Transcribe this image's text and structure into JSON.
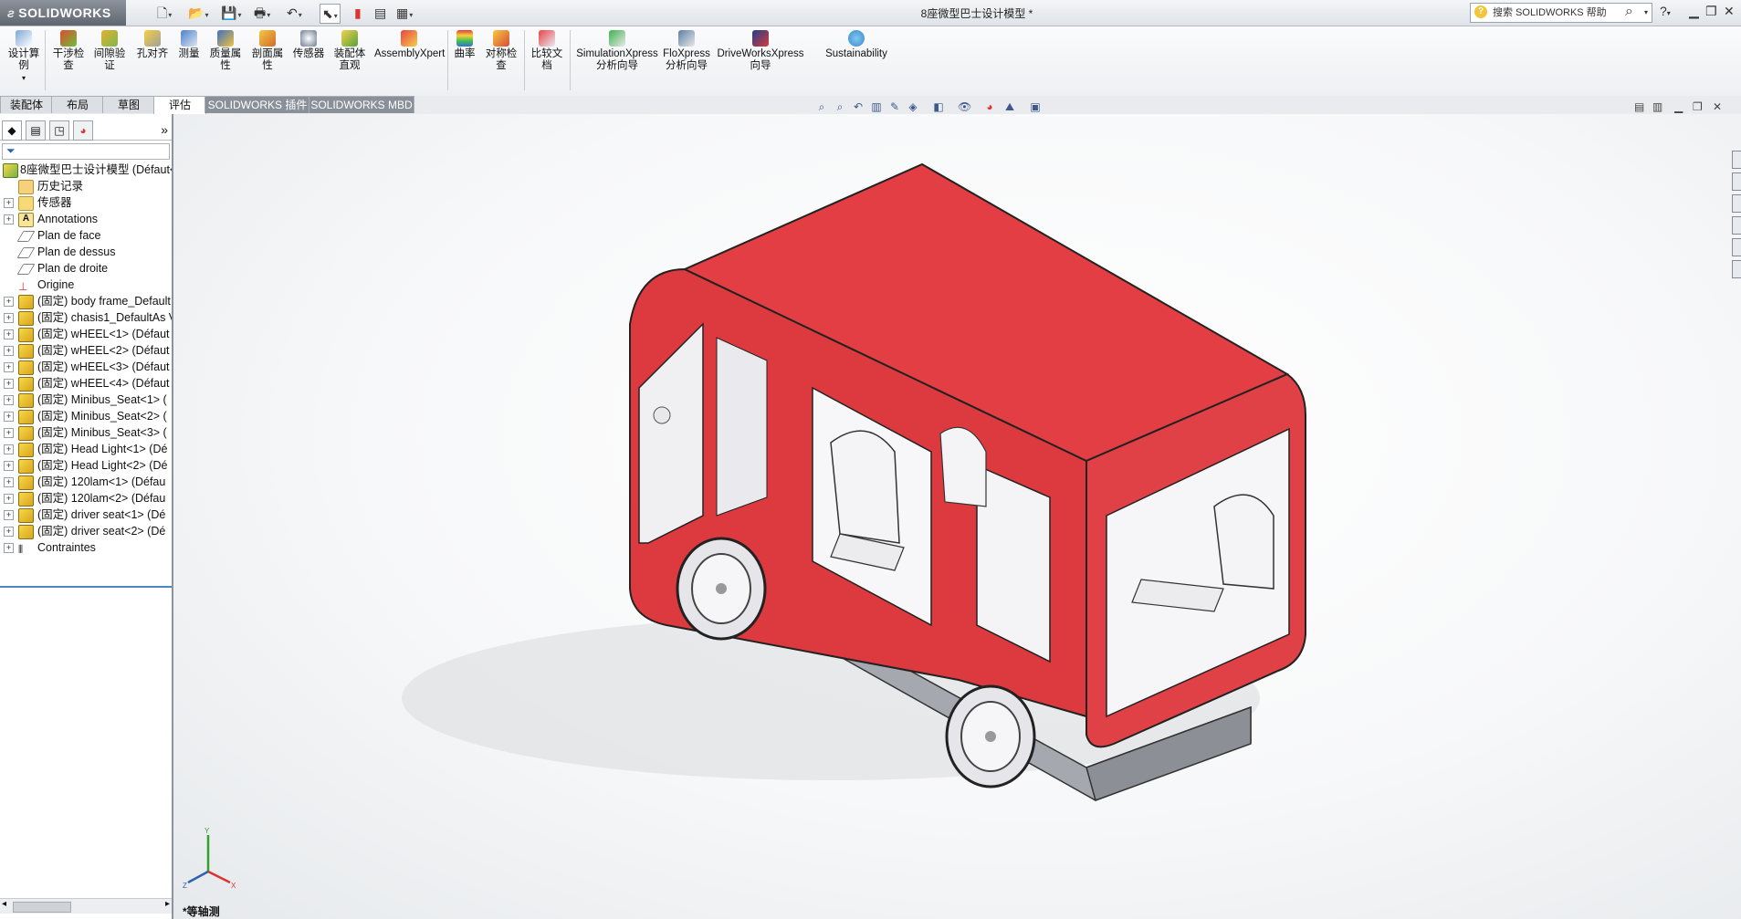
{
  "app": {
    "logo_text": "SOLIDWORKS",
    "document_title": "8座微型巴士设计模型 *",
    "search_placeholder": "搜索 SOLIDWORKS 帮助"
  },
  "ribbon": {
    "buttons": [
      {
        "label": "设计算\n例",
        "icon": "design-study-icon"
      },
      {
        "label": "干涉检\n查",
        "icon": "interference-icon"
      },
      {
        "label": "间隙验\n证",
        "icon": "clearance-icon"
      },
      {
        "label": "孔对齐",
        "icon": "hole-align-icon"
      },
      {
        "label": "测量",
        "icon": "measure-icon"
      },
      {
        "label": "质量属\n性",
        "icon": "mass-props-icon"
      },
      {
        "label": "剖面属\n性",
        "icon": "section-props-icon"
      },
      {
        "label": "传感器",
        "icon": "sensor-icon"
      },
      {
        "label": "装配体\n直观",
        "icon": "assembly-visual-icon"
      },
      {
        "label": "AssemblyXpert",
        "icon": "assemblyxpert-icon"
      },
      {
        "label": "曲率",
        "icon": "curvature-icon"
      },
      {
        "label": "对称检\n查",
        "icon": "symmetry-icon"
      },
      {
        "label": "比较文\n档",
        "icon": "compare-icon"
      },
      {
        "label": "SimulationXpress\n分析向导",
        "icon": "simulation-icon"
      },
      {
        "label": "FloXpress\n分析向导",
        "icon": "floxpress-icon"
      },
      {
        "label": "DriveWorksXpress\n向导",
        "icon": "driveworks-icon"
      },
      {
        "label": "Sustainability",
        "icon": "sustainability-icon"
      }
    ]
  },
  "tabs": [
    {
      "label": "装配体"
    },
    {
      "label": "布局"
    },
    {
      "label": "草图"
    },
    {
      "label": "评估",
      "active": true
    },
    {
      "label": "SOLIDWORKS 插件"
    },
    {
      "label": "SOLIDWORKS MBD"
    }
  ],
  "feature_tree": {
    "root": "8座微型巴士设计模型  (Défaut<D",
    "items": [
      {
        "label": "历史记录",
        "icon": "history-icon"
      },
      {
        "label": "传感器",
        "icon": "sensor-icon"
      },
      {
        "label": "Annotations",
        "icon": "annotations-icon"
      },
      {
        "label": "Plan de face",
        "icon": "plane-icon"
      },
      {
        "label": "Plan de dessus",
        "icon": "plane-icon"
      },
      {
        "label": "Plan de droite",
        "icon": "plane-icon"
      },
      {
        "label": "Origine",
        "icon": "origin-icon"
      },
      {
        "label": "(固定) body frame_Default",
        "icon": "part-icon"
      },
      {
        "label": "(固定) chasis1_DefaultAs V",
        "icon": "part-icon"
      },
      {
        "label": "(固定) wHEEL<1> (Défaut",
        "icon": "part-icon"
      },
      {
        "label": "(固定) wHEEL<2> (Défaut",
        "icon": "part-icon"
      },
      {
        "label": "(固定) wHEEL<3> (Défaut",
        "icon": "part-icon"
      },
      {
        "label": "(固定) wHEEL<4> (Défaut",
        "icon": "part-icon"
      },
      {
        "label": "(固定) Minibus_Seat<1> (",
        "icon": "part-icon"
      },
      {
        "label": "(固定) Minibus_Seat<2> (",
        "icon": "part-icon"
      },
      {
        "label": "(固定) Minibus_Seat<3> (",
        "icon": "part-icon"
      },
      {
        "label": "(固定) Head Light<1> (Dé",
        "icon": "part-icon"
      },
      {
        "label": "(固定) Head Light<2> (Dé",
        "icon": "part-icon"
      },
      {
        "label": "(固定) 120lam<1> (Défau",
        "icon": "part-icon"
      },
      {
        "label": "(固定) 120lam<2> (Défau",
        "icon": "part-icon"
      },
      {
        "label": "(固定) driver seat<1> (Dé",
        "icon": "part-icon"
      },
      {
        "label": "(固定) driver seat<2> (Dé",
        "icon": "part-icon"
      },
      {
        "label": "Contraintes",
        "icon": "mates-icon"
      }
    ]
  },
  "viewport": {
    "view_label": "*等轴测",
    "triad_axes": [
      "X",
      "Y",
      "Z"
    ]
  },
  "colors": {
    "body_red": "#dd3a3f",
    "body_red_dark": "#b8262c",
    "chassis_grey": "#a6a8b0",
    "seat_white": "#f4f4f6",
    "accent_blue": "#2b62b5"
  }
}
